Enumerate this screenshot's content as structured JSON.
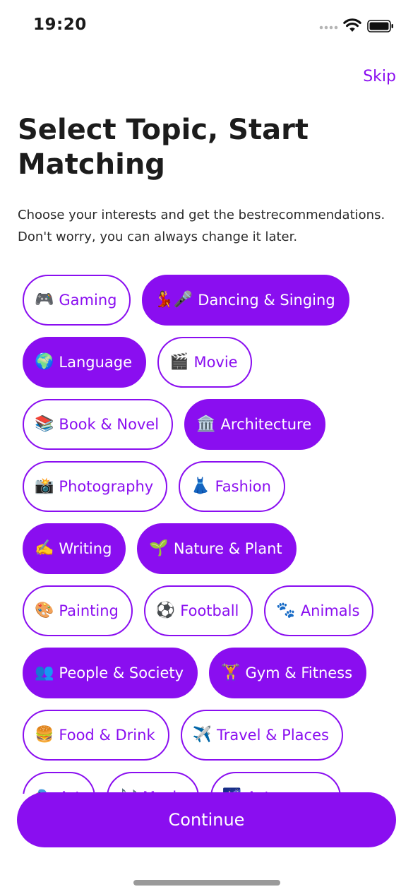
{
  "status_bar": {
    "time": "19:20"
  },
  "header": {
    "skip_label": "Skip"
  },
  "title": "Select Topic, Start Matching",
  "subtitle": "Choose your interests and get the bestrecommendations. Don't worry, you can always change it later.",
  "colors": {
    "accent": "#8a0ef0",
    "text": "#1c1c1c",
    "background": "#ffffff"
  },
  "topics": [
    [
      {
        "icon": "🎮",
        "icon_name": "game-controller-icon",
        "label": "Gaming",
        "selected": false
      },
      {
        "icon": "💃🎤",
        "icon_name": "dancer-microphone-icon",
        "label": "Dancing & Singing",
        "selected": true
      }
    ],
    [
      {
        "icon": "🌍",
        "icon_name": "globe-icon",
        "label": "Language",
        "selected": true
      },
      {
        "icon": "🎬",
        "icon_name": "clapper-board-icon",
        "label": "Movie",
        "selected": false
      }
    ],
    [
      {
        "icon": "📚",
        "icon_name": "books-icon",
        "label": "Book & Novel",
        "selected": false
      },
      {
        "icon": "🏛️",
        "icon_name": "classical-building-icon",
        "label": "Architecture",
        "selected": true
      }
    ],
    [
      {
        "icon": "📸",
        "icon_name": "camera-flash-icon",
        "label": "Photography",
        "selected": false
      },
      {
        "icon": "👗",
        "icon_name": "dress-icon",
        "label": "Fashion",
        "selected": false
      }
    ],
    [
      {
        "icon": "✍️",
        "icon_name": "writing-hand-icon",
        "label": "Writing",
        "selected": true
      },
      {
        "icon": "🌱",
        "icon_name": "seedling-icon",
        "label": "Nature & Plant",
        "selected": true
      }
    ],
    [
      {
        "icon": "🎨",
        "icon_name": "palette-icon",
        "label": "Painting",
        "selected": false
      },
      {
        "icon": "⚽",
        "icon_name": "soccer-ball-icon",
        "label": "Football",
        "selected": false
      },
      {
        "icon": "🐾",
        "icon_name": "paw-prints-icon",
        "label": "Animals",
        "selected": false
      }
    ],
    [
      {
        "icon": "👥",
        "icon_name": "people-icon",
        "label": "People & Society",
        "selected": true
      },
      {
        "icon": "🏋️",
        "icon_name": "weight-lifter-icon",
        "label": "Gym & Fitness",
        "selected": true
      }
    ],
    [
      {
        "icon": "🍔",
        "icon_name": "burger-icon",
        "label": "Food & Drink",
        "selected": false
      },
      {
        "icon": "✈️",
        "icon_name": "airplane-icon",
        "label": "Travel & Places",
        "selected": false
      }
    ],
    [
      {
        "icon": "🎭",
        "icon_name": "theater-masks-icon",
        "label": "Art",
        "selected": false
      },
      {
        "icon": "🎶",
        "icon_name": "music-notes-icon",
        "label": "Music",
        "selected": false
      },
      {
        "icon": "🌌",
        "icon_name": "milky-way-icon",
        "label": "Astronomy",
        "selected": false
      }
    ]
  ],
  "continue_label": "Continue"
}
